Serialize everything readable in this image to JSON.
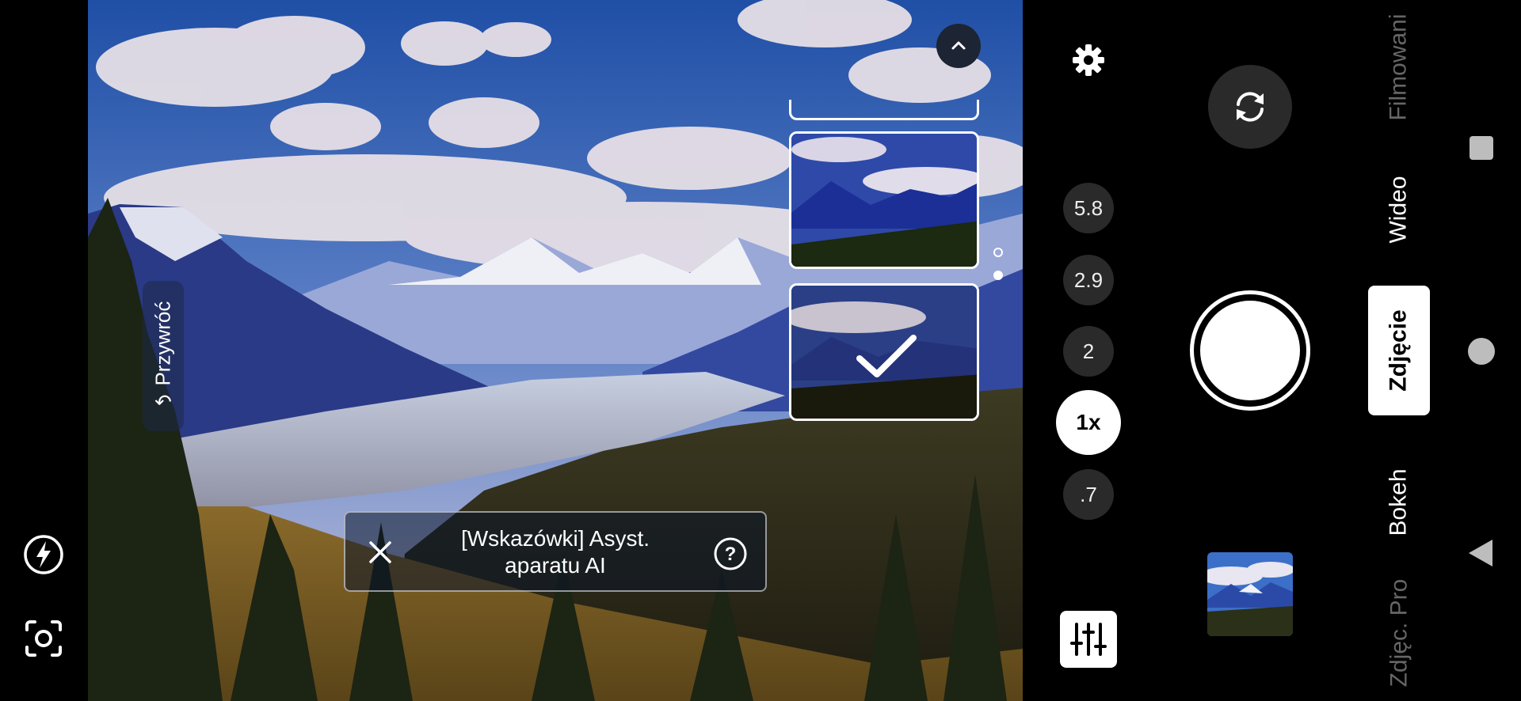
{
  "left_rail": {
    "flash_icon": "flash-auto-icon",
    "lens_icon": "ai-scene-icon"
  },
  "undo": {
    "label": "Przywróć",
    "icon": "undo-icon"
  },
  "ai_hint": {
    "line1": "[Wskazówki] Asyst.",
    "line2": "aparatu AI",
    "close_icon": "close-icon",
    "help_icon": "help-circle-icon"
  },
  "suggestions": {
    "collapse_icon": "chevron-up-icon",
    "selected_icon": "checkmark-icon",
    "page_dots": 2
  },
  "zoom_levels": [
    {
      "label": "5.8",
      "active": false
    },
    {
      "label": "2.9",
      "active": false
    },
    {
      "label": "2",
      "active": false
    },
    {
      "label": "1x",
      "active": true
    },
    {
      "label": ".7",
      "active": false
    }
  ],
  "controls": {
    "settings_icon": "gear-icon",
    "switch_camera_icon": "switch-camera-icon",
    "shutter_icon": "shutter-button",
    "filters_icon": "sliders-icon"
  },
  "modes": [
    {
      "label": "Filmowani",
      "active": false,
      "faded": true
    },
    {
      "label": "Wideo",
      "active": false,
      "faded": false
    },
    {
      "label": "Zdjęcie",
      "active": true,
      "faded": false
    },
    {
      "label": "Bokeh",
      "active": false,
      "faded": false
    },
    {
      "label": "Zdjęc. Pro",
      "active": false,
      "faded": true
    }
  ],
  "system_nav": {
    "recents_icon": "recents-square-icon",
    "home_icon": "home-circle-icon",
    "back_icon": "back-triangle-icon"
  },
  "colors": {
    "sky": "#3a63b8",
    "cloud": "#e9e2ea",
    "mountain": "#2d3f8c",
    "forest": "#2b2c1c",
    "active_pill": "#ffffff",
    "inactive_pill": "#2a2a2a"
  }
}
